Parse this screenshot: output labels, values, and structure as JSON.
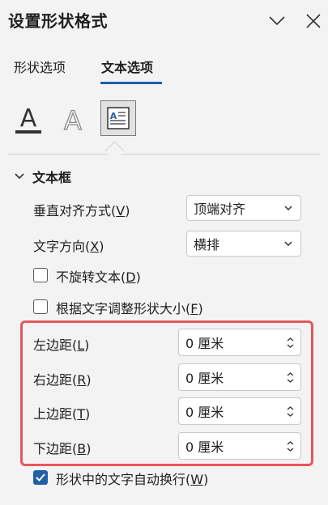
{
  "header": {
    "title": "设置形状格式",
    "collapse_icon": "chevron-down-icon",
    "close_icon": "close-icon"
  },
  "tabs": [
    {
      "label": "形状选项",
      "active": false
    },
    {
      "label": "文本选项",
      "active": true
    }
  ],
  "icon_tabs": [
    {
      "name": "text-fill-icon",
      "selected": false
    },
    {
      "name": "text-outline-icon",
      "selected": false
    },
    {
      "name": "textbox-icon",
      "selected": true
    }
  ],
  "section": {
    "title": "文本框",
    "expanded": true
  },
  "vertical_alignment": {
    "label": "垂直对齐方式(",
    "key": "V",
    "label_end": ")",
    "value": "顶端对齐"
  },
  "text_direction": {
    "label": "文字方向(",
    "key": "X",
    "label_end": ")",
    "value": "横排"
  },
  "checkbox_no_rotate": {
    "label": "不旋转文本(",
    "key": "D",
    "label_end": ")",
    "checked": false
  },
  "checkbox_autofit": {
    "label": "根据文字调整形状大小(",
    "key": "F",
    "label_end": ")",
    "checked": false
  },
  "margins": [
    {
      "label": "左边距(",
      "key": "L",
      "label_end": ")",
      "value": "0 厘米"
    },
    {
      "label": "右边距(",
      "key": "R",
      "label_end": ")",
      "value": "0 厘米"
    },
    {
      "label": "上边距(",
      "key": "T",
      "label_end": ")",
      "value": "0 厘米"
    },
    {
      "label": "下边距(",
      "key": "B",
      "label_end": ")",
      "value": "0 厘米"
    }
  ],
  "checkbox_wrap": {
    "label": "形状中的文字自动换行(",
    "key": "W",
    "label_end": ")",
    "checked": true
  },
  "colors": {
    "accent": "#1f5fa8",
    "highlight": "#e8565b"
  }
}
